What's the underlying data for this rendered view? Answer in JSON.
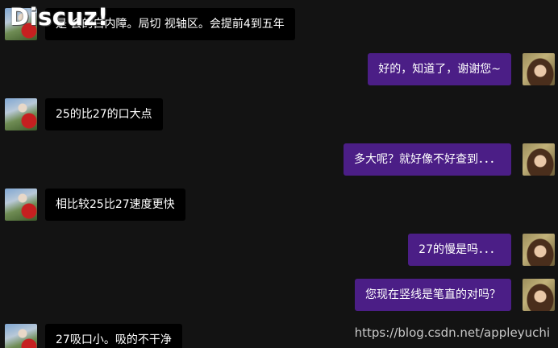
{
  "logo_text": "Discuz!",
  "watermark": "https://blog.csdn.net/appleyuchi",
  "messages": [
    {
      "side": "left",
      "text": "是 会的白内障。局切   视轴区。会提前4到五年"
    },
    {
      "side": "right",
      "text": "好的，知道了，谢谢您~"
    },
    {
      "side": "left",
      "text": "25的比27的口大点"
    },
    {
      "side": "right",
      "text": "多大呢？就好像不好查到．．．"
    },
    {
      "side": "left",
      "text": "相比较25比27速度更快"
    },
    {
      "side": "right",
      "text": "27的慢是吗．．．"
    },
    {
      "side": "right",
      "text": "您现在竖线是笔直的对吗？"
    },
    {
      "side": "left",
      "text": "27吸口小。吸的不干净"
    }
  ],
  "colors": {
    "background": "#131313",
    "left_bubble": "#000000",
    "right_bubble": "#4b1e86"
  }
}
